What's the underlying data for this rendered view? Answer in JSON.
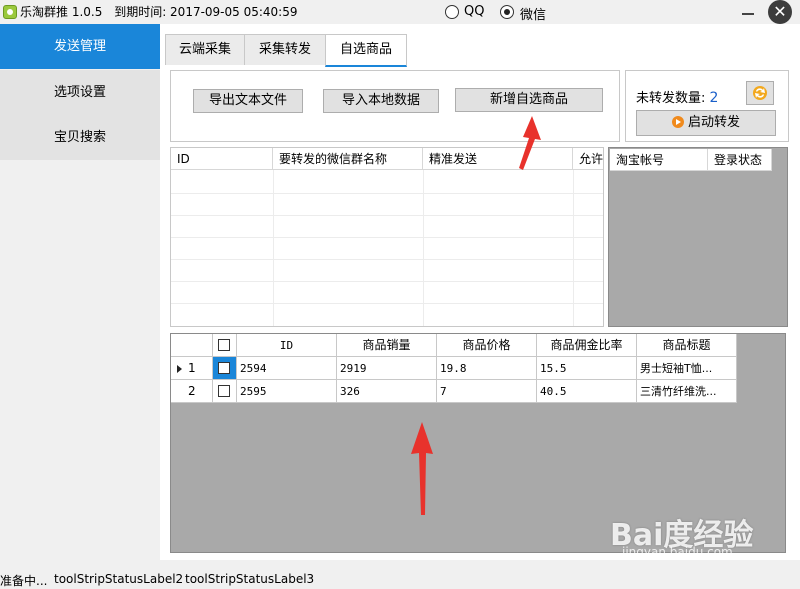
{
  "window": {
    "app_title": "乐淘群推 1.0.5",
    "expiry": "到期时间: 2017-09-05 05:40:59",
    "radio_qq": "QQ",
    "radio_wechat": "微信",
    "close_glyph": "✕"
  },
  "sidebar": {
    "items": [
      {
        "label": "发送管理"
      },
      {
        "label": "选项设置"
      },
      {
        "label": "宝贝搜索"
      }
    ]
  },
  "tabs": [
    {
      "label": "云端采集"
    },
    {
      "label": "采集转发"
    },
    {
      "label": "自选商品"
    }
  ],
  "toolbar": {
    "export_label": "导出文本文件",
    "import_label": "导入本地数据",
    "add_label": "新增自选商品"
  },
  "forward_panel": {
    "count_label": "未转发数量:",
    "count_value": "2",
    "start_label": "启动转发"
  },
  "group_grid": {
    "columns": [
      "ID",
      "要转发的微信群名称",
      "精准发送",
      "允许"
    ]
  },
  "account_grid": {
    "columns": [
      "淘宝帐号",
      "登录状态"
    ]
  },
  "goods_grid": {
    "columns": [
      "ID",
      "商品销量",
      "商品价格",
      "商品佣金比率",
      "商品标题"
    ],
    "rows": [
      {
        "row_num": "1",
        "id": "2594",
        "sales": "2919",
        "price": "19.8",
        "rate": "15.5",
        "title": "男士短袖T恤..."
      },
      {
        "row_num": "2",
        "id": "2595",
        "sales": "326",
        "price": "7",
        "rate": "40.5",
        "title": "三清竹纤维洗..."
      }
    ]
  },
  "status_bar": {
    "item1": "准备中...",
    "item2": "toolStripStatusLabel2",
    "item3": "toolStripStatusLabel3"
  },
  "watermark": {
    "text": "Bai度经验",
    "sub": "jingyan.baidu.com"
  },
  "colors": {
    "accent": "#1a86d9",
    "arrow": "#e8322c"
  },
  "icons": [
    "app-icon",
    "refresh-icon",
    "play-icon",
    "close-icon",
    "minimize-icon",
    "row-pointer-icon"
  ]
}
